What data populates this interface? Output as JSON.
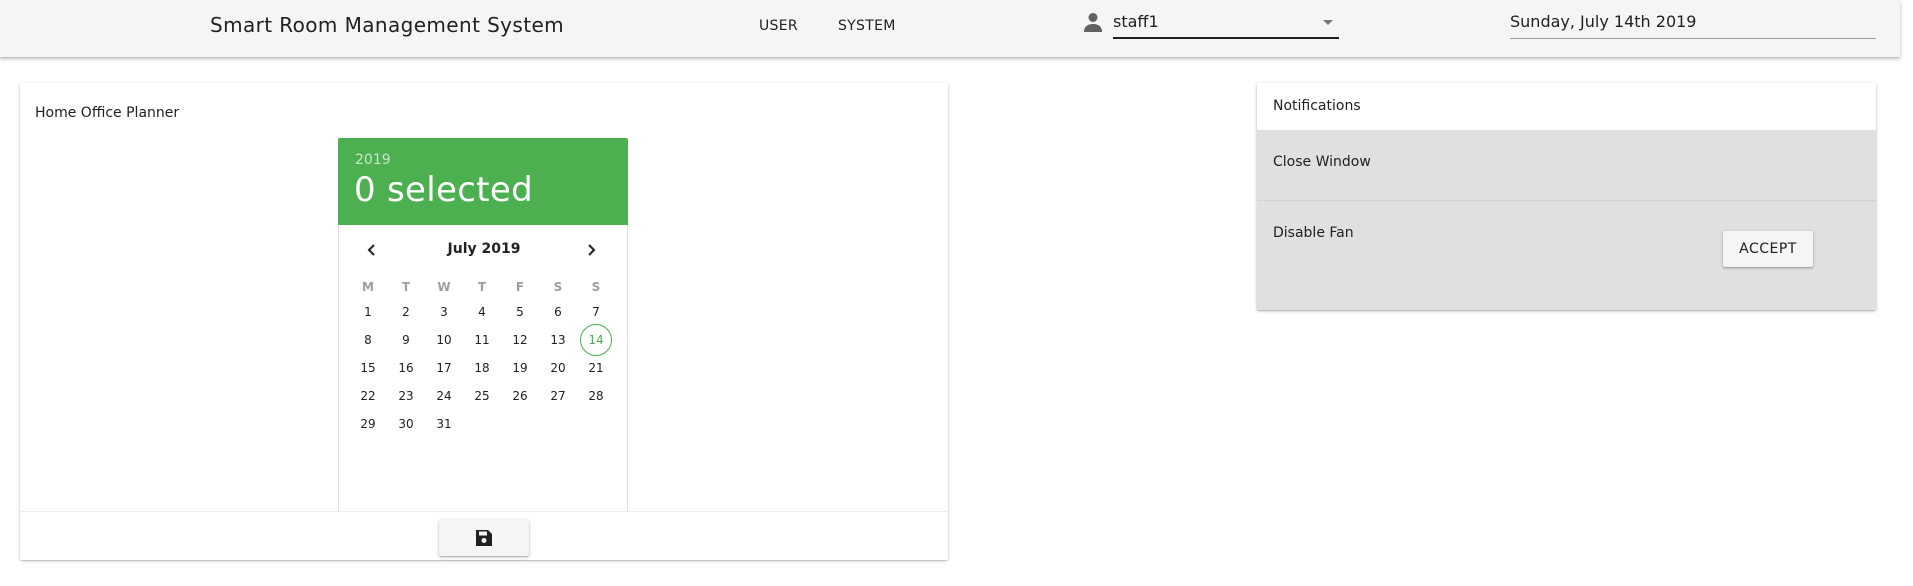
{
  "app": {
    "title": "Smart Room Management System"
  },
  "nav": {
    "user_label": "USER",
    "system_label": "SYSTEM"
  },
  "user_select": {
    "icon": "person-icon",
    "value": "staff1"
  },
  "date_field": {
    "value": "Sunday, July 14th 2019"
  },
  "planner": {
    "title": "Home Office Planner",
    "calendar": {
      "year": "2019",
      "selected_label": "0 selected",
      "month_label": "July 2019",
      "weekdays": [
        "M",
        "T",
        "W",
        "T",
        "F",
        "S",
        "S"
      ],
      "first_weekday_index": 0,
      "days_in_month": 31,
      "today": 14,
      "accent_color": "#4caf50"
    },
    "save_icon": "save-icon"
  },
  "notifications": {
    "title": "Notifications",
    "items": [
      {
        "label": "Close Window"
      },
      {
        "label": "Disable Fan"
      }
    ],
    "accept_label": "ACCEPT"
  }
}
